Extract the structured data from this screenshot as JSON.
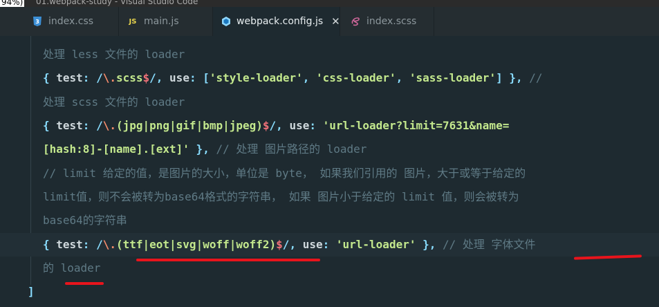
{
  "window": {
    "zoom_badge": "94%)",
    "title": "01.webpack-study - Visual Studio Code"
  },
  "tabs": [
    {
      "label": "index.css",
      "icon": "css-file-icon",
      "icon_color": "#3c8fd6",
      "active": false
    },
    {
      "label": "main.js",
      "icon": "js-file-icon",
      "icon_color": "#e8d44d",
      "active": false
    },
    {
      "label": "webpack.config.js",
      "icon": "webpack-file-icon",
      "icon_color": "#8ed6fb",
      "active": true
    },
    {
      "label": "index.scss",
      "icon": "scss-file-icon",
      "icon_color": "#cd6799",
      "active": false
    }
  ],
  "code": {
    "l1": "处理 less 文件的 loader",
    "l2": {
      "open": "{ ",
      "key": "test",
      "colon": ": ",
      "rx_open": "/",
      "rx_esc": "\\.",
      "rx_body": "scss",
      "rx_end": "$",
      "rx_close": "/",
      "comma": ", ",
      "use": "use",
      "arr": ": [",
      "s1": "'style-loader'",
      "sep1": ", ",
      "s2": "'css-loader'",
      "sep2": ", ",
      "s3": "'sass-loader'",
      "close": "] }, ",
      "cm": "//"
    },
    "l3": "处理 scss 文件的 loader",
    "l4": {
      "open": "{ ",
      "key": "test",
      "colon": ": ",
      "rx_open": "/",
      "rx_esc": "\\.",
      "rx_body": "(jpg|png|gif|bmp|jpeg)",
      "rx_end": "$",
      "rx_close": "/",
      "comma": ", ",
      "use": "use",
      "colon2": ": ",
      "s": "'url-loader?limit=7631&name="
    },
    "l5": {
      "s": "[hash:8]-[name].[ext]'",
      "close": " }, ",
      "cm": "// 处理 图片路径的 loader"
    },
    "l6": "// limit 给定的值，是图片的大小，单位是 byte， 如果我们引用的 图片，大于或等于给定的",
    "l7": "limit值，则不会被转为base64格式的字符串， 如果 图片小于给定的 limit 值，则会被转为",
    "l8": "base64的字符串",
    "l9": {
      "open": "{ ",
      "key": "test",
      "colon": ": ",
      "rx_open": "/",
      "rx_esc": "\\.",
      "rx_body": "(ttf|eot|svg|woff|woff2)",
      "rx_end": "$",
      "rx_close": "/",
      "comma": ", ",
      "use": "use",
      "colon2": ": ",
      "s": "'url-loader'",
      "close": " }, ",
      "cm": "// 处理 字体文件"
    },
    "l10": "的 loader",
    "l11": "]"
  },
  "annotations": {
    "color": "#e8141c"
  }
}
